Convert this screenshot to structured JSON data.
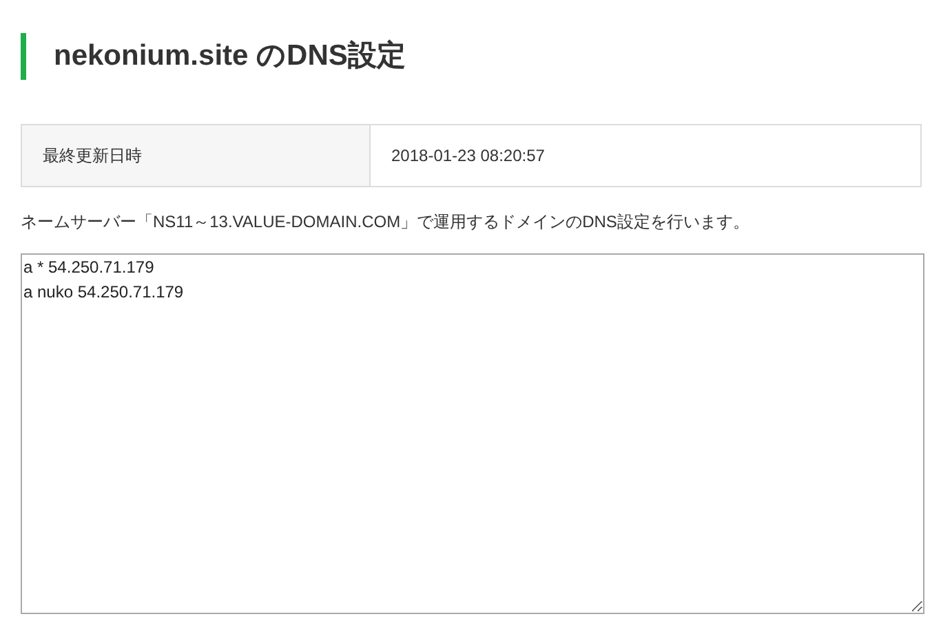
{
  "heading": "nekonium.site のDNS設定",
  "info_table": [
    {
      "label": "最終更新日時",
      "value": "2018-01-23 08:20:57"
    }
  ],
  "description": "ネームサーバー「NS11～13.VALUE-DOMAIN.COM」で運用するドメインのDNS設定を行います。",
  "dns_records": {
    "value": "a * 54.250.71.179\na nuko 54.250.71.179"
  }
}
